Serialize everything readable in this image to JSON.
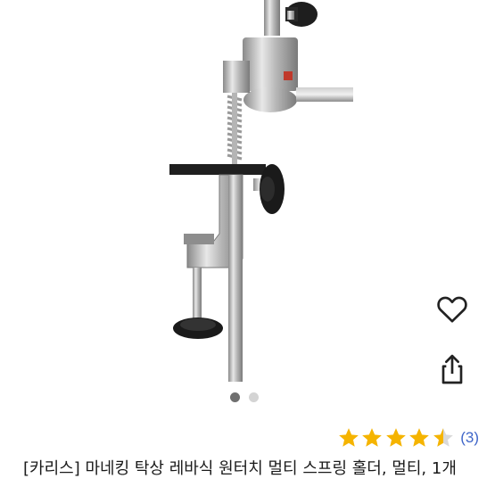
{
  "gallery": {
    "image_alt": "manequin table clamp holder photo",
    "current_index": 1,
    "total_images": 2
  },
  "actions": {
    "favorite_icon": "heart-outline-icon",
    "share_icon": "share-icon"
  },
  "rating": {
    "value": 4.5,
    "max": 5,
    "star_color": "#f5b400",
    "review_count": "(3)"
  },
  "product": {
    "title": "[카리스] 마네킹 탁상 레바식 원터치 멀티 스프링 홀더, 멀티, 1개"
  },
  "colors": {
    "link": "#3f66c9",
    "dot_active": "#6f6f6f",
    "dot_inactive": "#d4d4d4"
  }
}
